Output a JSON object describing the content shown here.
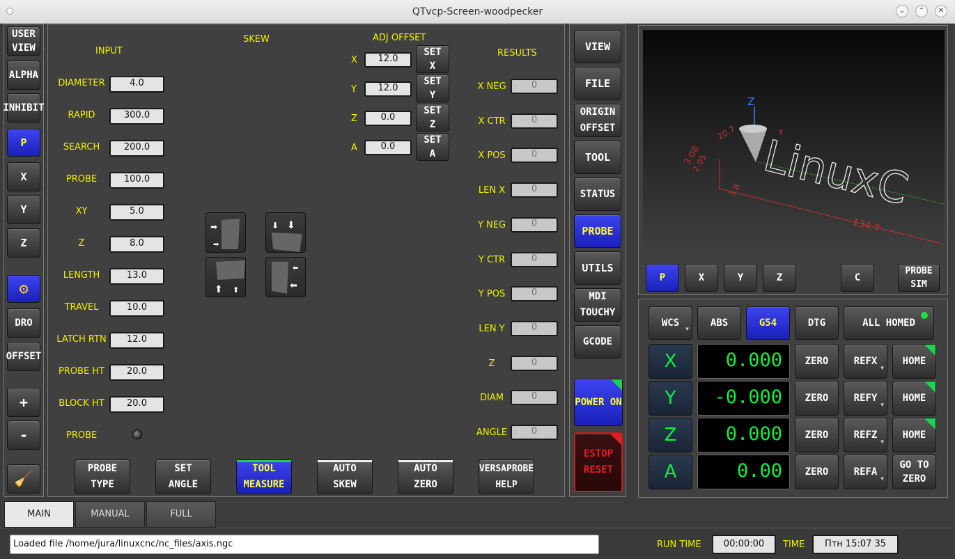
{
  "window": {
    "title": "QTvcp-Screen-woodpecker"
  },
  "left_toolbar": {
    "user_view": "USER VIEW",
    "alpha": "ALPHA",
    "inhibit": "INHIBIT",
    "p": "P",
    "x": "X",
    "y": "Y",
    "z": "Z",
    "dro": "DRO",
    "offset": "OFFSET",
    "plus": "+",
    "minus": "-"
  },
  "probe": {
    "input_title": "INPUT",
    "skew_title": "SKEW",
    "adj_title": "ADJ OFFSET",
    "results_title": "RESULTS",
    "inputs": [
      {
        "label": "DIAMETER",
        "value": "4.0"
      },
      {
        "label": "RAPID",
        "value": "300.0"
      },
      {
        "label": "SEARCH",
        "value": "200.0"
      },
      {
        "label": "PROBE",
        "value": "100.0"
      },
      {
        "label": "XY",
        "value": "5.0"
      },
      {
        "label": "Z",
        "value": "8.0"
      },
      {
        "label": "LENGTH",
        "value": "13.0"
      },
      {
        "label": "TRAVEL",
        "value": "10.0"
      },
      {
        "label": "LATCH RTN",
        "value": "12.0"
      },
      {
        "label": "PROBE HT",
        "value": "20.0"
      },
      {
        "label": "BLOCK HT",
        "value": "20.0"
      }
    ],
    "probe_led_label": "PROBE",
    "adj": [
      {
        "axis": "X",
        "value": "12.0",
        "btn": "SET X"
      },
      {
        "axis": "Y",
        "value": "12.0",
        "btn": "SET Y"
      },
      {
        "axis": "Z",
        "value": "0.0",
        "btn": "SET Z"
      },
      {
        "axis": "A",
        "value": "0.0",
        "btn": "SET A"
      }
    ],
    "results": [
      {
        "label": "X NEG",
        "value": "0"
      },
      {
        "label": "X CTR",
        "value": "0"
      },
      {
        "label": "X POS",
        "value": "0"
      },
      {
        "label": "LEN X",
        "value": "0"
      },
      {
        "label": "Y NEG",
        "value": "0"
      },
      {
        "label": "Y CTR",
        "value": "0"
      },
      {
        "label": "Y POS",
        "value": "0"
      },
      {
        "label": "LEN Y",
        "value": "0"
      },
      {
        "label": "Z",
        "value": "0"
      },
      {
        "label": "DIAM",
        "value": "0"
      },
      {
        "label": "ANGLE",
        "value": "0"
      }
    ],
    "bottom": {
      "probe_type": "PROBE TYPE",
      "set_angle": "SET ANGLE",
      "tool_measure": "TOOL MEASURE",
      "auto_skew": "AUTO SKEW",
      "auto_zero": "AUTO ZERO",
      "versaprobe_help": "VERSAPROBE HELP"
    }
  },
  "mid_toolbar": {
    "view": "VIEW",
    "file": "FILE",
    "origin_offset": "ORIGIN OFFSET",
    "tool": "TOOL",
    "status": "STATUS",
    "probe": "PROBE",
    "utils": "UTILS",
    "mdi_touchy": "MDI TOUCHY",
    "gcode": "GCODE",
    "power_on": "POWER ON",
    "estop_reset": "ESTOP RESET"
  },
  "preview": {
    "axis_z": "Z",
    "axis_y": "Y",
    "dim1": "20.7",
    "dim2": "3.08",
    "dim3": "2.05",
    "dim4": "1.8",
    "dim5": "134.7",
    "text": "LinuxC",
    "buttons": {
      "p": "P",
      "x": "X",
      "y": "Y",
      "z": "Z",
      "c": "C",
      "probe_sim": "PROBE SIM"
    }
  },
  "dro": {
    "wcs": "WCS",
    "abs": "ABS",
    "g54": "G54",
    "dtg": "DTG",
    "all_homed": "ALL HOMED",
    "rows": [
      {
        "axis": "X",
        "value": "0.000",
        "zero": "ZERO",
        "ref": "REFX",
        "home": "HOME"
      },
      {
        "axis": "Y",
        "value": "-0.000",
        "zero": "ZERO",
        "ref": "REFY",
        "home": "HOME"
      },
      {
        "axis": "Z",
        "value": "0.000",
        "zero": "ZERO",
        "ref": "REFZ",
        "home": "HOME"
      },
      {
        "axis": "A",
        "value": "0.00",
        "zero": "ZERO",
        "ref": "REFA",
        "home": "GO TO ZERO"
      }
    ]
  },
  "tabs": {
    "main": "MAIN",
    "manual": "MANUAL",
    "full": "FULL"
  },
  "status": {
    "message": "Loaded file /home/jura/linuxcnc/nc_files/axis.ngc",
    "run_time_label": "RUN TIME",
    "run_time": "00:00:00",
    "time_label": "TIME",
    "time": "Птн 15:07 35"
  },
  "colors": {
    "accent": "#f0f000",
    "blue": "#2a30d8",
    "green": "#10f040",
    "red": "#e02020"
  }
}
